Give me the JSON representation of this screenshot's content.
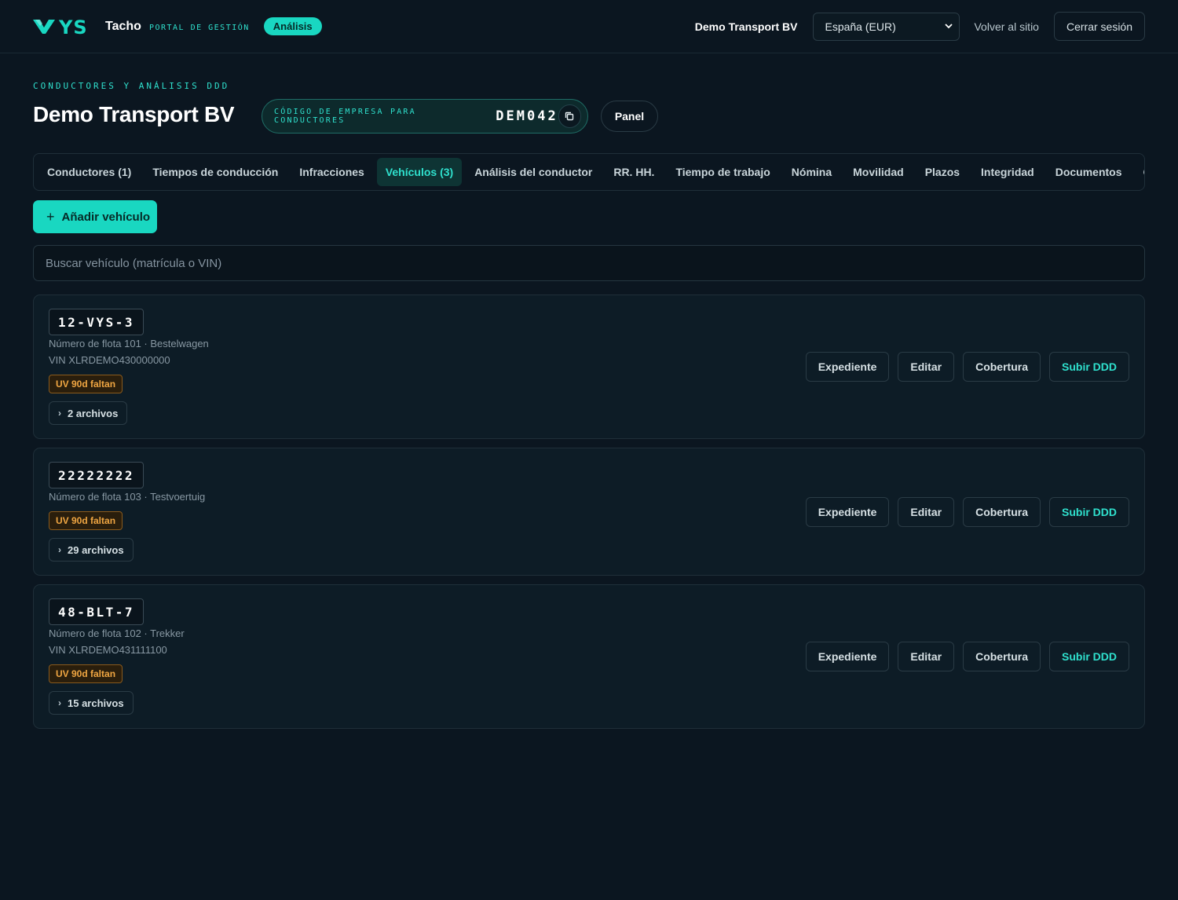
{
  "header": {
    "logo_text": "VYS",
    "brand": "Tacho",
    "brand_sub": "PORTAL DE GESTIÓN",
    "mode_badge": "Análisis",
    "company": "Demo Transport BV",
    "country_select": "España (EUR)",
    "back_link": "Volver al sitio",
    "logout": "Cerrar sesión"
  },
  "page": {
    "kicker": "CONDUCTORES Y ANÁLISIS DDD",
    "title": "Demo Transport BV",
    "code_label": "CÓDIGO DE EMPRESA PARA CONDUCTORES",
    "code_value": "DEM042",
    "panel_button": "Panel"
  },
  "tabs": [
    {
      "label": "Conductores (1)"
    },
    {
      "label": "Tiempos de conducción"
    },
    {
      "label": "Infracciones"
    },
    {
      "label": "Vehículos (3)",
      "active": true
    },
    {
      "label": "Análisis del conductor"
    },
    {
      "label": "RR. HH."
    },
    {
      "label": "Tiempo de trabajo"
    },
    {
      "label": "Nómina"
    },
    {
      "label": "Movilidad"
    },
    {
      "label": "Plazos"
    },
    {
      "label": "Integridad"
    },
    {
      "label": "Documentos"
    },
    {
      "label": "Organización"
    }
  ],
  "toolbar": {
    "add_vehicle": "Añadir vehículo",
    "search_placeholder": "Buscar vehículo (matrícula o VIN)"
  },
  "vehicles": [
    {
      "plate": "12-VYS-3",
      "fleet": "Número de flota 101 · Bestelwagen",
      "vin": "VIN XLRDEMO430000000",
      "badge": "UV 90d faltan",
      "files": "2 archivos"
    },
    {
      "plate": "22222222",
      "fleet": "Número de flota 103 · Testvoertuig",
      "badge": "UV 90d faltan",
      "files": "29 archivos"
    },
    {
      "plate": "48-BLT-7",
      "fleet": "Número de flota 102 · Trekker",
      "vin": "VIN XLRDEMO431111100",
      "badge": "UV 90d faltan",
      "files": "15 archivos"
    }
  ],
  "vehicle_actions": {
    "record": "Expediente",
    "edit": "Editar",
    "coverage": "Cobertura",
    "upload": "Subir DDD"
  },
  "colors": {
    "accent": "#19d7c1",
    "background": "#0b1620",
    "warning": "#f0a642"
  }
}
